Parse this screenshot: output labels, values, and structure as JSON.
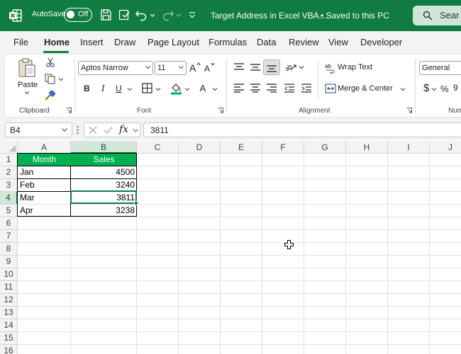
{
  "titlebar": {
    "autosave_label": "AutoSave",
    "autosave_state": "Off",
    "doc_title": "Target Address in Excel VBA....",
    "save_status": "• Saved to this PC",
    "search_placeholder": "Sear"
  },
  "tabs": [
    "File",
    "Home",
    "Insert",
    "Draw",
    "Page Layout",
    "Formulas",
    "Data",
    "Review",
    "View",
    "Developer"
  ],
  "active_tab": "Home",
  "ribbon": {
    "clipboard": {
      "label": "Clipboard",
      "paste": "Paste"
    },
    "font": {
      "label": "Font",
      "font_name": "Aptos Narrow",
      "font_size": "11",
      "bold": "B",
      "italic": "I",
      "underline": "U"
    },
    "alignment": {
      "label": "Alignment",
      "wrap_text": "Wrap Text",
      "merge_center": "Merge & Center"
    },
    "number": {
      "label": "Num",
      "format": "General",
      "currency": "$",
      "percent": "%"
    }
  },
  "formula_bar": {
    "name_box": "B4",
    "fx": "fx",
    "formula": "3811"
  },
  "sheet": {
    "columns": [
      "A",
      "B",
      "C",
      "D",
      "E",
      "F",
      "G",
      "H",
      "I",
      "J"
    ],
    "rows": [
      "1",
      "2",
      "3",
      "4",
      "5",
      "6",
      "7",
      "8",
      "9",
      "10",
      "11",
      "12",
      "13",
      "14",
      "15",
      "16"
    ],
    "table_headers": [
      "Month",
      "Sales"
    ],
    "table_rows": [
      [
        "Jan",
        "4500"
      ],
      [
        "Feb",
        "3240"
      ],
      [
        "Mar",
        "3811"
      ],
      [
        "Apr",
        "3238"
      ]
    ],
    "selected_cell": "B4"
  },
  "colors": {
    "brand": "#107c41",
    "header_fill": "#00b050"
  }
}
